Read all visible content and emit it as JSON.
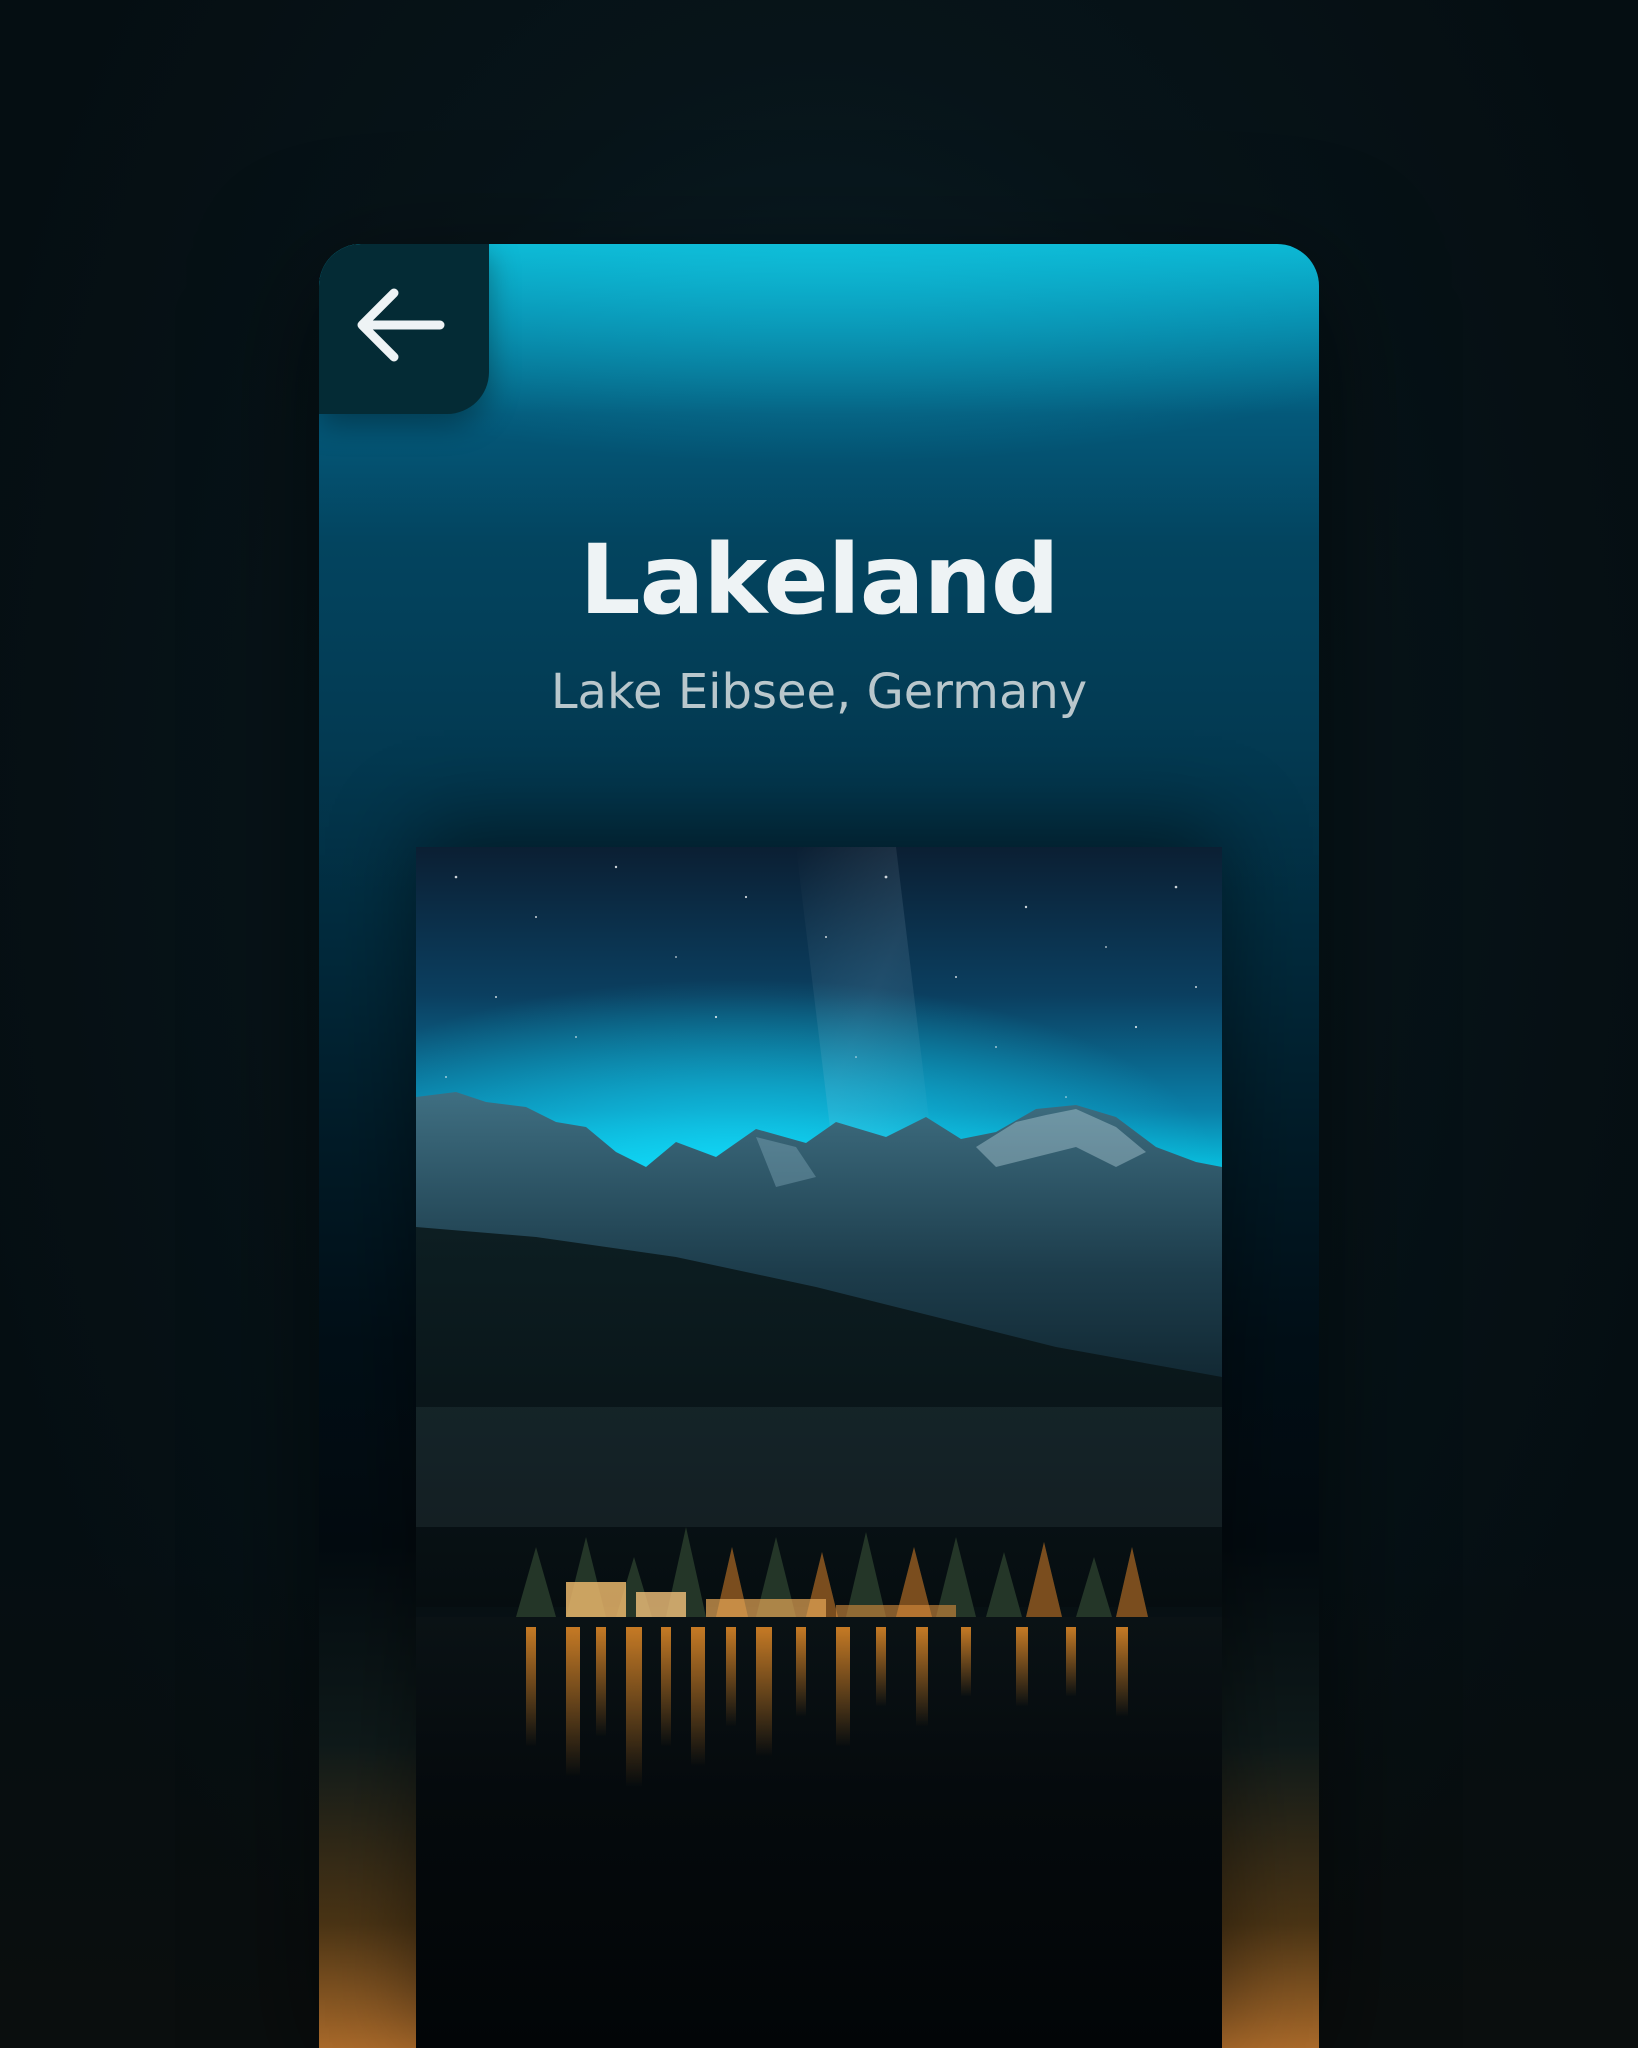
{
  "header": {
    "back_button": {
      "icon": "arrow-left-icon"
    }
  },
  "destination": {
    "title": "Lakeland",
    "location": "Lake Eibsee, Germany"
  },
  "photo": {
    "subject": "lake-eibsee-night-photo"
  },
  "colors": {
    "accent_cyan": "#0bb6d3",
    "card_deep": "#033a52",
    "back_button_bg": "#042b35",
    "title_text": "#eef3f5",
    "subtitle_text": "#b9c7cc",
    "warm_glow": "#a8692a"
  }
}
